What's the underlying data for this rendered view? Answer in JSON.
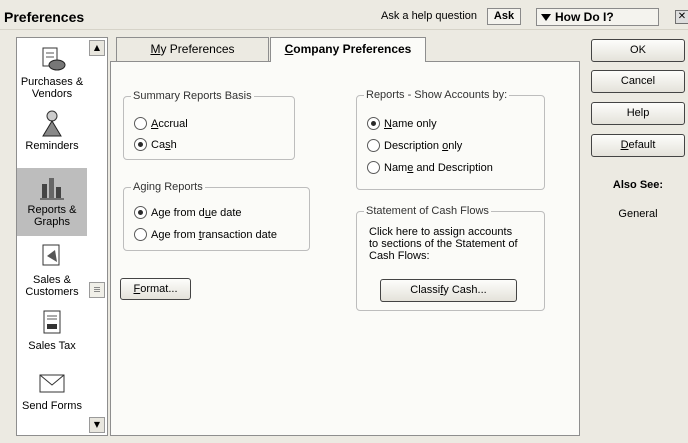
{
  "window": {
    "title": "Preferences",
    "help_prompt": "Ask a help question",
    "ask_label": "Ask",
    "how_do_i_label": "How Do I?",
    "close_glyph": "✕"
  },
  "sidebar": {
    "items": [
      {
        "label": "Purchases & Vendors",
        "icon": "purchases-vendors-icon"
      },
      {
        "label": "Reminders",
        "icon": "reminders-icon"
      },
      {
        "label": "Reports & Graphs",
        "icon": "reports-graphs-icon",
        "selected": true
      },
      {
        "label": "Sales & Customers",
        "icon": "sales-customers-icon"
      },
      {
        "label": "Sales Tax",
        "icon": "sales-tax-icon"
      },
      {
        "label": "Send Forms",
        "icon": "send-forms-icon"
      }
    ]
  },
  "tabs": {
    "my_prefix": "",
    "my_accel": "M",
    "my_rest": "y Preferences",
    "company_prefix": "",
    "company_accel": "C",
    "company_rest": "ompany Preferences",
    "active": "Company Preferences"
  },
  "summary_basis": {
    "legend": "Summary Reports Basis",
    "options": [
      {
        "pre": "",
        "accel": "A",
        "post": "ccrual",
        "selected": false
      },
      {
        "pre": "Ca",
        "accel": "s",
        "post": "h",
        "selected": true
      }
    ]
  },
  "aging": {
    "legend": "Aging Reports",
    "options": [
      {
        "pre": "Age from d",
        "accel": "u",
        "post": "e date",
        "selected": true
      },
      {
        "pre": "Age from ",
        "accel": "t",
        "post": "ransaction date",
        "selected": false
      }
    ]
  },
  "show_accounts": {
    "legend": "Reports - Show Accounts by:",
    "options": [
      {
        "pre": "",
        "accel": "N",
        "post": "ame only",
        "selected": true
      },
      {
        "pre": "Description ",
        "accel": "o",
        "post": "nly",
        "selected": false
      },
      {
        "pre": "Nam",
        "accel": "e",
        "post": " and Description",
        "selected": false
      }
    ]
  },
  "cash_flows": {
    "legend": "Statement of Cash Flows",
    "text_line1": "Click here to assign accounts",
    "text_line2": "to sections of the Statement of",
    "text_line3": "Cash Flows:",
    "classify_pre": "Classi",
    "classify_accel": "f",
    "classify_post": "y Cash..."
  },
  "format_button": {
    "accel": "F",
    "rest": "ormat..."
  },
  "actions": {
    "ok": "OK",
    "cancel": "Cancel",
    "help": "Help",
    "default_accel": "D",
    "default_rest": "efault"
  },
  "also_see": {
    "title": "Also See:",
    "link": "General"
  }
}
